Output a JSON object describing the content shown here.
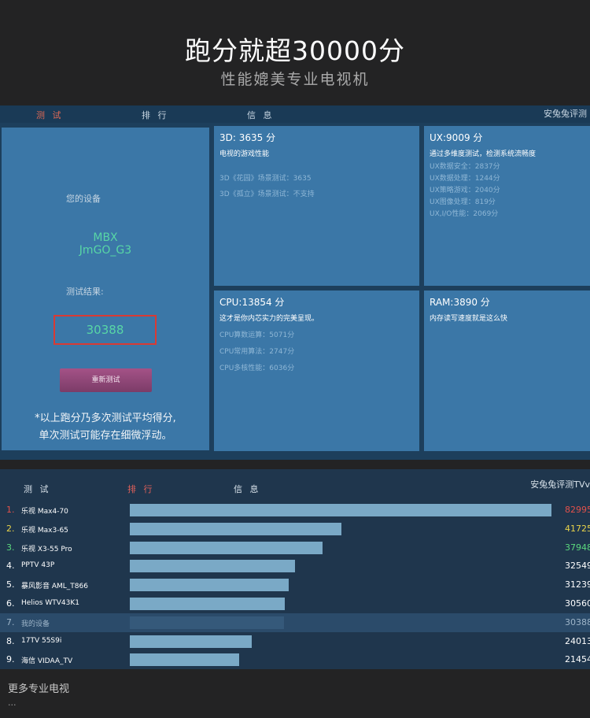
{
  "header": {
    "title": "跑分就超30000分",
    "subtitle": "性能媲美专业电视机"
  },
  "screen1": {
    "tabs": [
      "测 试",
      "排 行",
      "信 息"
    ],
    "active_tab": 0,
    "right_label": "安兔兔评测",
    "device_label": "您的设备",
    "device_name_line1": "MBX",
    "device_name_line2": "JmGO_G3",
    "result_label": "测试结果:",
    "score": "30388",
    "retest_button": "重新测试",
    "note_line1": "*以上跑分乃多次测试平均得分,",
    "note_line2": "单次测试可能存在细微浮动。",
    "panels": {
      "p3d": {
        "title": "3D: 3635 分",
        "desc": "电视的游戏性能",
        "items": [
          "3D《花园》场景测试：3635",
          "3D《孤立》场景测试：不支持"
        ]
      },
      "ux": {
        "title": "UX:9009 分",
        "desc": "通过多维度测试，检测系统流畅度",
        "items": [
          "UX数据安全：2837分",
          "UX数据处理：1244分",
          "UX策略游戏：2040分",
          "UX图像处理：819分",
          "UX,I/O性能：2069分"
        ]
      },
      "cpu": {
        "title": "CPU:13854 分",
        "desc": "这才是你内芯实力的完美呈现。",
        "items": [
          "CPU算数运算：5071分",
          "CPU常用算法：2747分",
          "CPU多核性能：6036分"
        ]
      },
      "ram": {
        "title": "RAM:3890 分",
        "desc": "内存读写速度就是这么快",
        "items": []
      }
    }
  },
  "screen2": {
    "tabs": [
      "测 试",
      "排 行",
      "信 息"
    ],
    "active_tab": 1,
    "right_label": "安兔兔评测TVv",
    "max_value": 83000,
    "rows": [
      {
        "rank": "1.",
        "name": "乐视 Max4-70",
        "value": "82995",
        "num": 82995,
        "color": "#e2514b"
      },
      {
        "rank": "2.",
        "name": "乐视 Max3-65",
        "value": "41725",
        "num": 41725,
        "color": "#e8d34a"
      },
      {
        "rank": "3.",
        "name": "乐视 X3-55 Pro",
        "value": "37948",
        "num": 37948,
        "color": "#5bd97d"
      },
      {
        "rank": "4.",
        "name": "PPTV 43P",
        "value": "32549",
        "num": 32549,
        "color": "#ffffff"
      },
      {
        "rank": "5.",
        "name": "暴风影音 AML_T866",
        "value": "31239",
        "num": 31239,
        "color": "#ffffff"
      },
      {
        "rank": "6.",
        "name": "Helios WTV43K1",
        "value": "30560",
        "num": 30560,
        "color": "#ffffff"
      },
      {
        "rank": "7.",
        "name": "我的设备",
        "value": "30388",
        "num": 30388,
        "color": "#9db4c8",
        "mine": true
      },
      {
        "rank": "8.",
        "name": "17TV 55S9i",
        "value": "24013",
        "num": 24013,
        "color": "#ffffff"
      },
      {
        "rank": "9.",
        "name": "海信 VIDAA_TV",
        "value": "21454",
        "num": 21454,
        "color": "#ffffff"
      }
    ]
  },
  "footer": {
    "more_label": "更多专业电视",
    "ellipsis": "..."
  }
}
